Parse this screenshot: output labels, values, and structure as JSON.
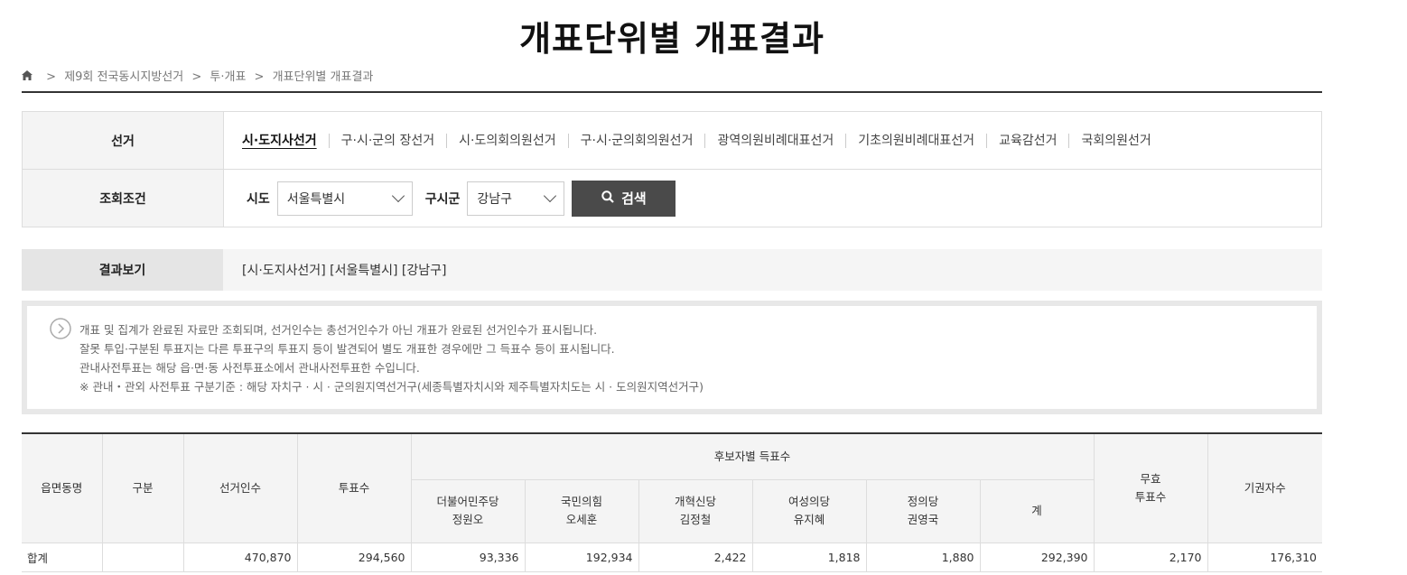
{
  "page_title": "개표단위별 개표결과",
  "breadcrumb": [
    "제9회 전국동시지방선거",
    "투·개표",
    "개표단위별 개표결과"
  ],
  "filter": {
    "election_label": "선거",
    "tabs": [
      "시·도지사선거",
      "구·시·군의 장선거",
      "시·도의회의원선거",
      "구·시·군의회의원선거",
      "광역의원비례대표선거",
      "기초의원비례대표선거",
      "교육감선거",
      "국회의원선거"
    ],
    "condition_label": "조회조건",
    "sido_label": "시도",
    "sido_value": "서울특별시",
    "sigungu_label": "구시군",
    "sigungu_value": "강남구",
    "search_label": "검색"
  },
  "result": {
    "label": "결과보기",
    "value": "[시·도지사선거] [서울특별시] [강남구]"
  },
  "notice": [
    "개표 및 집계가 완료된 자료만 조회되며, 선거인수는 총선거인수가 아닌 개표가 완료된 선거인수가 표시됩니다.",
    "잘못 투입·구분된 투표지는 다른 투표구의 투표지 등이 발견되어 별도 개표한 경우에만 그 득표수 등이 표시됩니다.",
    "관내사전투표는 해당 읍·면·동 사전투표소에서 관내사전투표한 수입니다.",
    "※ 관내・관외 사전투표 구분기준 : 해당 자치구 · 시 · 군의원지역선거구(세종특별자치시와 제주특별자치도는 시 · 도의원지역선거구)"
  ],
  "table": {
    "headers": {
      "district": "읍면동명",
      "type": "구분",
      "electors": "선거인수",
      "votes": "투표수",
      "candidates_group": "후보자별 득표수",
      "candidates": [
        {
          "party": "더불어민주당",
          "name": "정원오"
        },
        {
          "party": "국민의힘",
          "name": "오세훈"
        },
        {
          "party": "개혁신당",
          "name": "김정철"
        },
        {
          "party": "여성의당",
          "name": "유지혜"
        },
        {
          "party": "정의당",
          "name": "권영국"
        }
      ],
      "total": "계",
      "invalid_1": "무효",
      "invalid_2": "투표수",
      "abstain": "기권자수"
    },
    "rows": [
      {
        "district": "합계",
        "type": "",
        "electors": "470,870",
        "votes": "294,560",
        "c1": "93,336",
        "c2": "192,934",
        "c3": "2,422",
        "c4": "1,818",
        "c5": "1,880",
        "total": "292,390",
        "invalid": "2,170",
        "abstain": "176,310"
      }
    ]
  }
}
